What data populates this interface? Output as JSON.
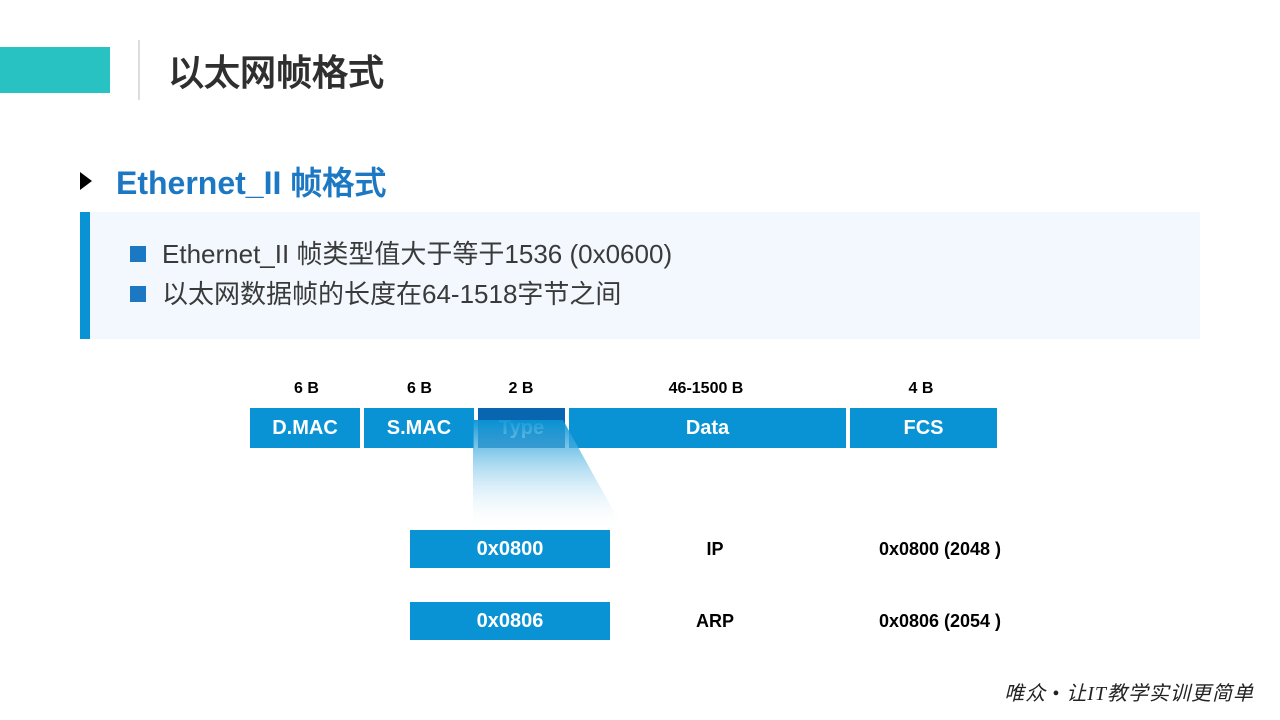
{
  "title": "以太网帧格式",
  "subtitle": "Ethernet_II 帧格式",
  "info": {
    "line1": "Ethernet_II 帧类型值大于等于1536 (0x0600)",
    "line2": "以太网数据帧的长度在64-1518字节之间"
  },
  "frame": {
    "byte_labels": {
      "dmac": "6 B",
      "smac": "6 B",
      "type": "2 B",
      "data": "46-1500 B",
      "fcs": "4 B"
    },
    "cells": {
      "dmac": "D.MAC",
      "smac": "S.MAC",
      "type": "Type",
      "data": "Data",
      "fcs": "FCS"
    }
  },
  "types": [
    {
      "hex": "0x0800",
      "proto": "IP",
      "decimal": "0x0800 (2048 )"
    },
    {
      "hex": "0x0806",
      "proto": "ARP",
      "decimal": "0x0806 (2054 )"
    }
  ],
  "footer": "唯众 • 让IT教学实训更简单"
}
